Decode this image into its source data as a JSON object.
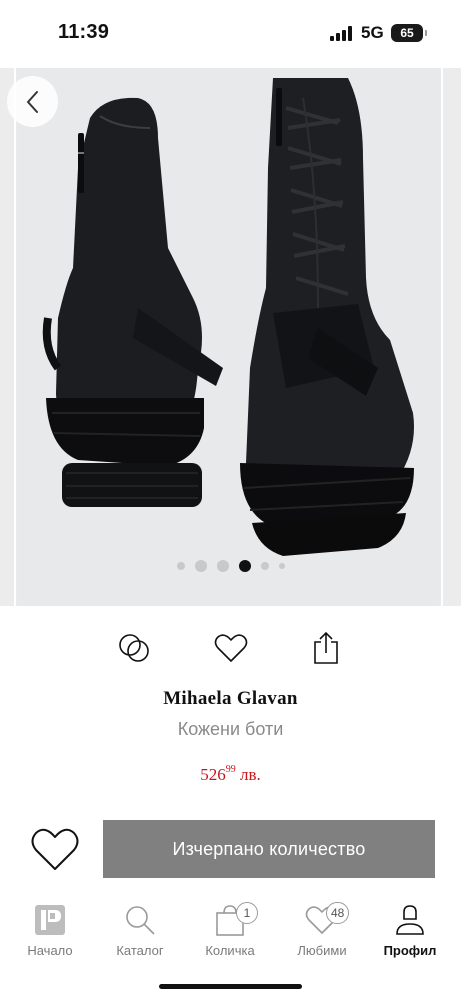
{
  "status_bar": {
    "time": "11:39",
    "network": "5G",
    "battery": "65"
  },
  "gallery": {
    "back_icon": "chevron-left-icon",
    "dot_count": 6,
    "active_dot_index": 3
  },
  "actions": {
    "compare_icon": "compare-circles-icon",
    "favorite_icon": "heart-outline-icon",
    "share_icon": "share-icon"
  },
  "product": {
    "brand": "Mihaela Glavan",
    "name": "Кожени боти",
    "price_main": "526",
    "price_cents": "99",
    "currency": "лв."
  },
  "purchase": {
    "sold_out_label": "Изчерпано количество",
    "favorite_icon": "heart-outline-icon"
  },
  "tabbar": {
    "items": [
      {
        "label": "Начало",
        "icon": "home-logo-icon"
      },
      {
        "label": "Каталог",
        "icon": "search-icon"
      },
      {
        "label": "Количка",
        "icon": "cart-bag-icon",
        "badge": "1"
      },
      {
        "label": "Любими",
        "icon": "heart-icon",
        "badge": "48"
      },
      {
        "label": "Профил",
        "icon": "user-icon"
      }
    ],
    "active_index": 4
  },
  "colors": {
    "price": "#c8161d",
    "button": "#808080"
  }
}
